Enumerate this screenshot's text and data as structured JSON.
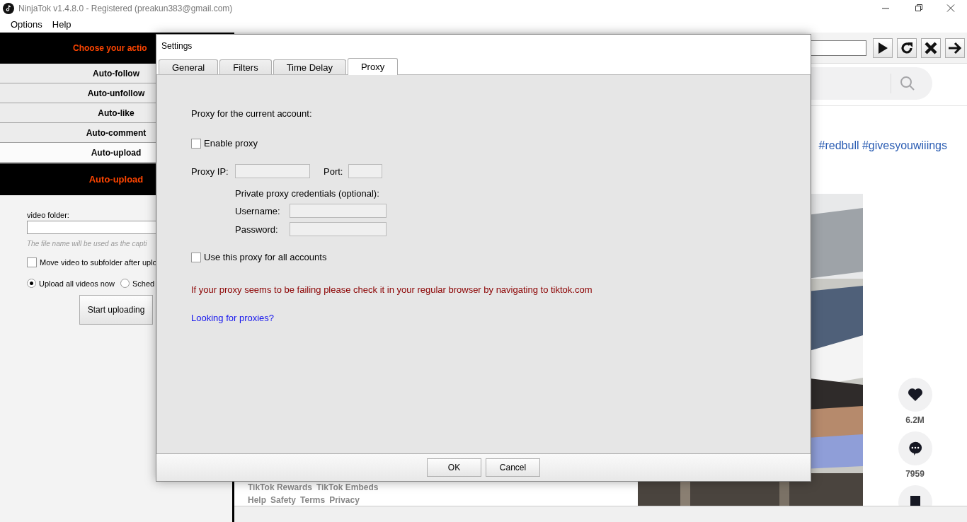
{
  "window": {
    "title": "NinjaTok v1.4.8.0 - Registered (preakun383@gmail.com)"
  },
  "menu": [
    "Options",
    "Help"
  ],
  "left_panel": {
    "header": "Choose your actio",
    "actions": [
      {
        "label": "Auto-follow",
        "selected": false
      },
      {
        "label": "Auto-unfollow",
        "selected": false
      },
      {
        "label": "Auto-like",
        "selected": false
      },
      {
        "label": "Auto-comment",
        "selected": false
      },
      {
        "label": "Auto-upload",
        "selected": true
      }
    ],
    "section_title": "Auto-upload",
    "folder_label": "video folder:",
    "hint": "The file name will be used as the capti",
    "move_checkbox": {
      "label": "Move video to subfolder after uplo",
      "checked": false
    },
    "radios": [
      {
        "label": "Upload all videos now",
        "selected": true
      },
      {
        "label": "Sched",
        "selected": false
      }
    ],
    "start_button": "Start uploading"
  },
  "browser": {
    "caption": "#redbull #givesyouwiiings",
    "actions": [
      {
        "kind": "like",
        "count": "6.2M"
      },
      {
        "kind": "comment",
        "count": "7959"
      },
      {
        "kind": "save"
      }
    ],
    "footer_links": [
      "TikTok Rewards",
      "TikTok Embeds"
    ],
    "footer_links_2": [
      "Help",
      "Safety",
      "Terms",
      "Privacy"
    ]
  },
  "dialog": {
    "title": "Settings",
    "tabs": [
      {
        "label": "General",
        "selected": false
      },
      {
        "label": "Filters",
        "selected": false
      },
      {
        "label": "Time Delay",
        "selected": false
      },
      {
        "label": "Proxy",
        "selected": true
      }
    ],
    "heading": "Proxy for the current account:",
    "enable_proxy": {
      "label": "Enable proxy",
      "checked": false
    },
    "proxy_ip_label": "Proxy IP:",
    "port_label": "Port:",
    "credentials_label": "Private proxy credentials (optional):",
    "username_label": "Username:",
    "password_label": "Password:",
    "all_accounts": {
      "label": "Use this proxy for all accounts",
      "checked": false
    },
    "warning": "If your proxy seems to be failing please check it in your regular browser by navigating to tiktok.com",
    "link": "Looking for proxies?",
    "buttons": [
      "OK",
      "Cancel"
    ]
  }
}
